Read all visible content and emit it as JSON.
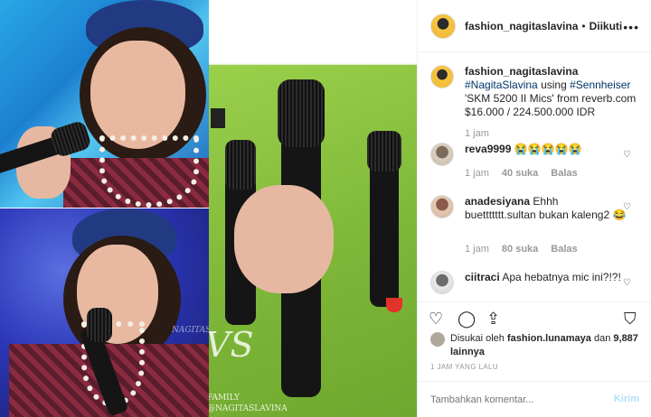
{
  "post": {
    "username": "fashion_nagitaslavina",
    "separator": "•",
    "follow_label": "Diikuti",
    "more": "•••"
  },
  "caption": {
    "username": "fashion_nagitaslavina",
    "hashtag1": "#NagitaSlavina",
    "text1": "using",
    "hashtag2": "#Sennheiser",
    "text2": "'SKM 5200 II Mics' from reverb.com $16.000 / 224.500.000 IDR",
    "time": "1 jam"
  },
  "comments": [
    {
      "username": "reva9999",
      "text": "😭😭😭😭😭",
      "time": "1 jam",
      "likes": "40 suka",
      "reply": "Balas"
    },
    {
      "username": "anadesiyana",
      "text": "Ehhh buettttttt.sultan bukan kaleng2 😂",
      "time": "1 jam",
      "likes": "80 suka",
      "reply": "Balas"
    },
    {
      "username": "ciitraci",
      "text": "Apa hebatnya mic ini?!?!"
    }
  ],
  "likes": {
    "prefix": "Disukai oleh",
    "liker": "fashion.lunamaya",
    "conj": "dan",
    "others": "9,887 lainnya"
  },
  "timestamp": "1 JAM YANG LALU",
  "add_comment": {
    "placeholder": "Tambahkan komentar...",
    "post_label": "Kirim"
  },
  "photo": {
    "watermark_1": "NAGITASLAVINA",
    "watermark_2": "VS",
    "watermark_3": "FAMILY",
    "watermark_4": "@NAGITASLAVINA"
  },
  "icons": {
    "heart": "heart-icon",
    "comment": "comment-icon",
    "share": "share-icon",
    "save": "bookmark-icon"
  },
  "colors": {
    "link": "#003569",
    "post_button_disabled": "#b2dffc",
    "secondary_text": "#999999"
  }
}
